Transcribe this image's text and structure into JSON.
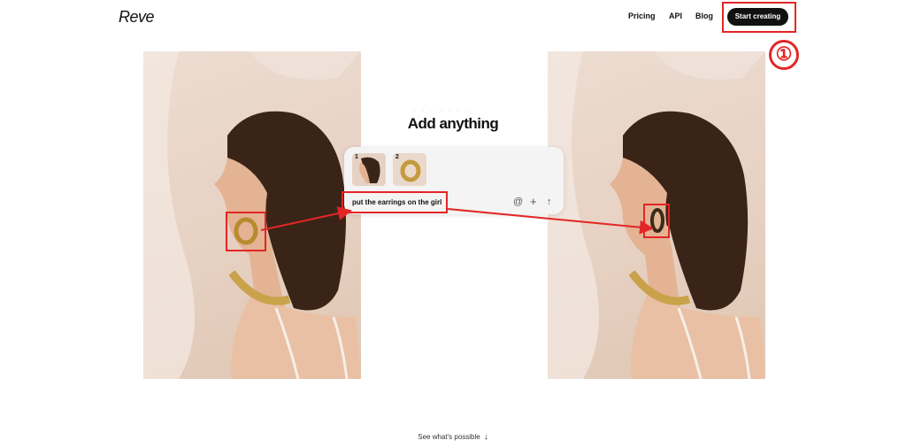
{
  "header": {
    "logo": "Reve",
    "nav": {
      "pricing": "Pricing",
      "api": "API",
      "blog": "Blog"
    },
    "cta_label": "Start creating"
  },
  "annotation": {
    "step_number": "①",
    "highlight_color": "#e32626"
  },
  "hero": {
    "headline": "Add anything",
    "prompt": {
      "reference_numbers": [
        "1",
        "2"
      ],
      "text": "put the earrings on the girl",
      "icons": [
        "at-mention-icon",
        "plus-icon",
        "submit-arrow-up-icon"
      ]
    }
  },
  "footer": {
    "see_more": "See what's possible"
  },
  "colors": {
    "cta_bg": "#111111",
    "accent_red": "#e32626",
    "photo_bg": "#e8d4c6"
  }
}
